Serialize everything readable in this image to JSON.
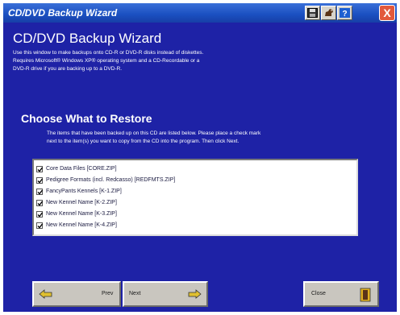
{
  "window": {
    "title": "CD/DVD Backup Wizard",
    "icons": [
      "save-disk-icon",
      "dog-icon",
      "help-icon",
      "close-icon"
    ],
    "close_label": "X"
  },
  "main": {
    "heading": "CD/DVD Backup Wizard",
    "description": [
      "Use this window to make backups onto CD-R or DVD-R disks instead of diskettes.",
      "Requires Microsoft® Windows XP® operating system and a CD-Recordable or a",
      "DVD-R drive if you are backing up to a DVD-R."
    ],
    "section_title": "Choose What to Restore",
    "instructions": [
      "The items that have been backed up on this CD are listed below.  Please place a check mark",
      "next to the item(s) you want to copy from the CD into the program.  Then click Next."
    ],
    "items": [
      {
        "label": "Core Data Files [CORE.ZIP]",
        "checked": true
      },
      {
        "label": "Pedigree Formats (incl. Redcasso) [REDFMTS.ZIP]",
        "checked": true
      },
      {
        "label": "FancyPants Kennels [K-1.ZIP]",
        "checked": true
      },
      {
        "label": "New Kennel Name [K-2.ZIP]",
        "checked": true
      },
      {
        "label": "New Kennel Name [K-3.ZIP]",
        "checked": true
      },
      {
        "label": "New Kennel Name [K-4.ZIP]",
        "checked": true
      }
    ]
  },
  "buttons": {
    "prev_label": "Prev",
    "next_label": "Next",
    "close_label": "Close"
  },
  "colors": {
    "background": "#1e22a6",
    "titlebar": "#1a4fc0",
    "text": "#ffffff"
  }
}
